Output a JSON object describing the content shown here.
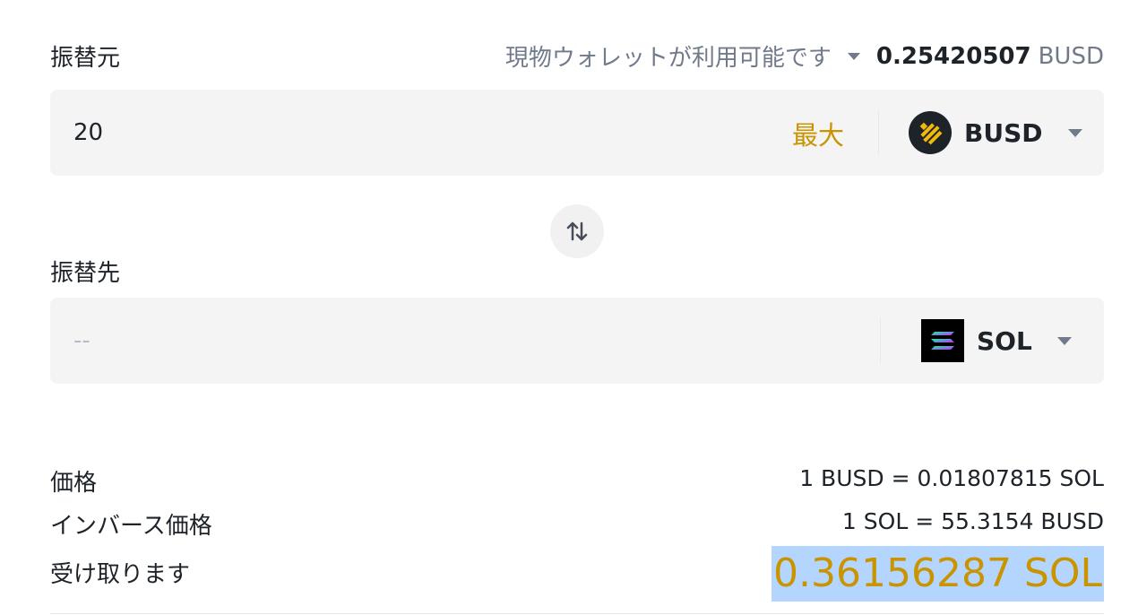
{
  "from": {
    "label": "振替元",
    "wallet_label": "現物ウォレットが利用可能です",
    "balance": "0.25420507",
    "balance_unit": "BUSD",
    "amount": "20",
    "max_label": "最大",
    "coin": "BUSD"
  },
  "to": {
    "label": "振替先",
    "placeholder": "--",
    "coin": "SOL"
  },
  "summary": {
    "price_label": "価格",
    "price_value": "1 BUSD = 0.01807815 SOL",
    "inverse_label": "インバース価格",
    "inverse_value": "1 SOL = 55.3154 BUSD",
    "receive_label": "受け取ります",
    "receive_value": "0.36156287 SOL"
  },
  "colors": {
    "accent": "#c99400",
    "busd_yellow": "#f0b90b",
    "text_secondary": "#707a8a",
    "input_bg": "#f4f4f4",
    "selection": "#b4d5fe"
  },
  "icons": {
    "busd": "busd-logo-icon",
    "sol": "sol-logo-icon",
    "swap": "swap-arrows-icon",
    "caret": "caret-down-icon"
  }
}
